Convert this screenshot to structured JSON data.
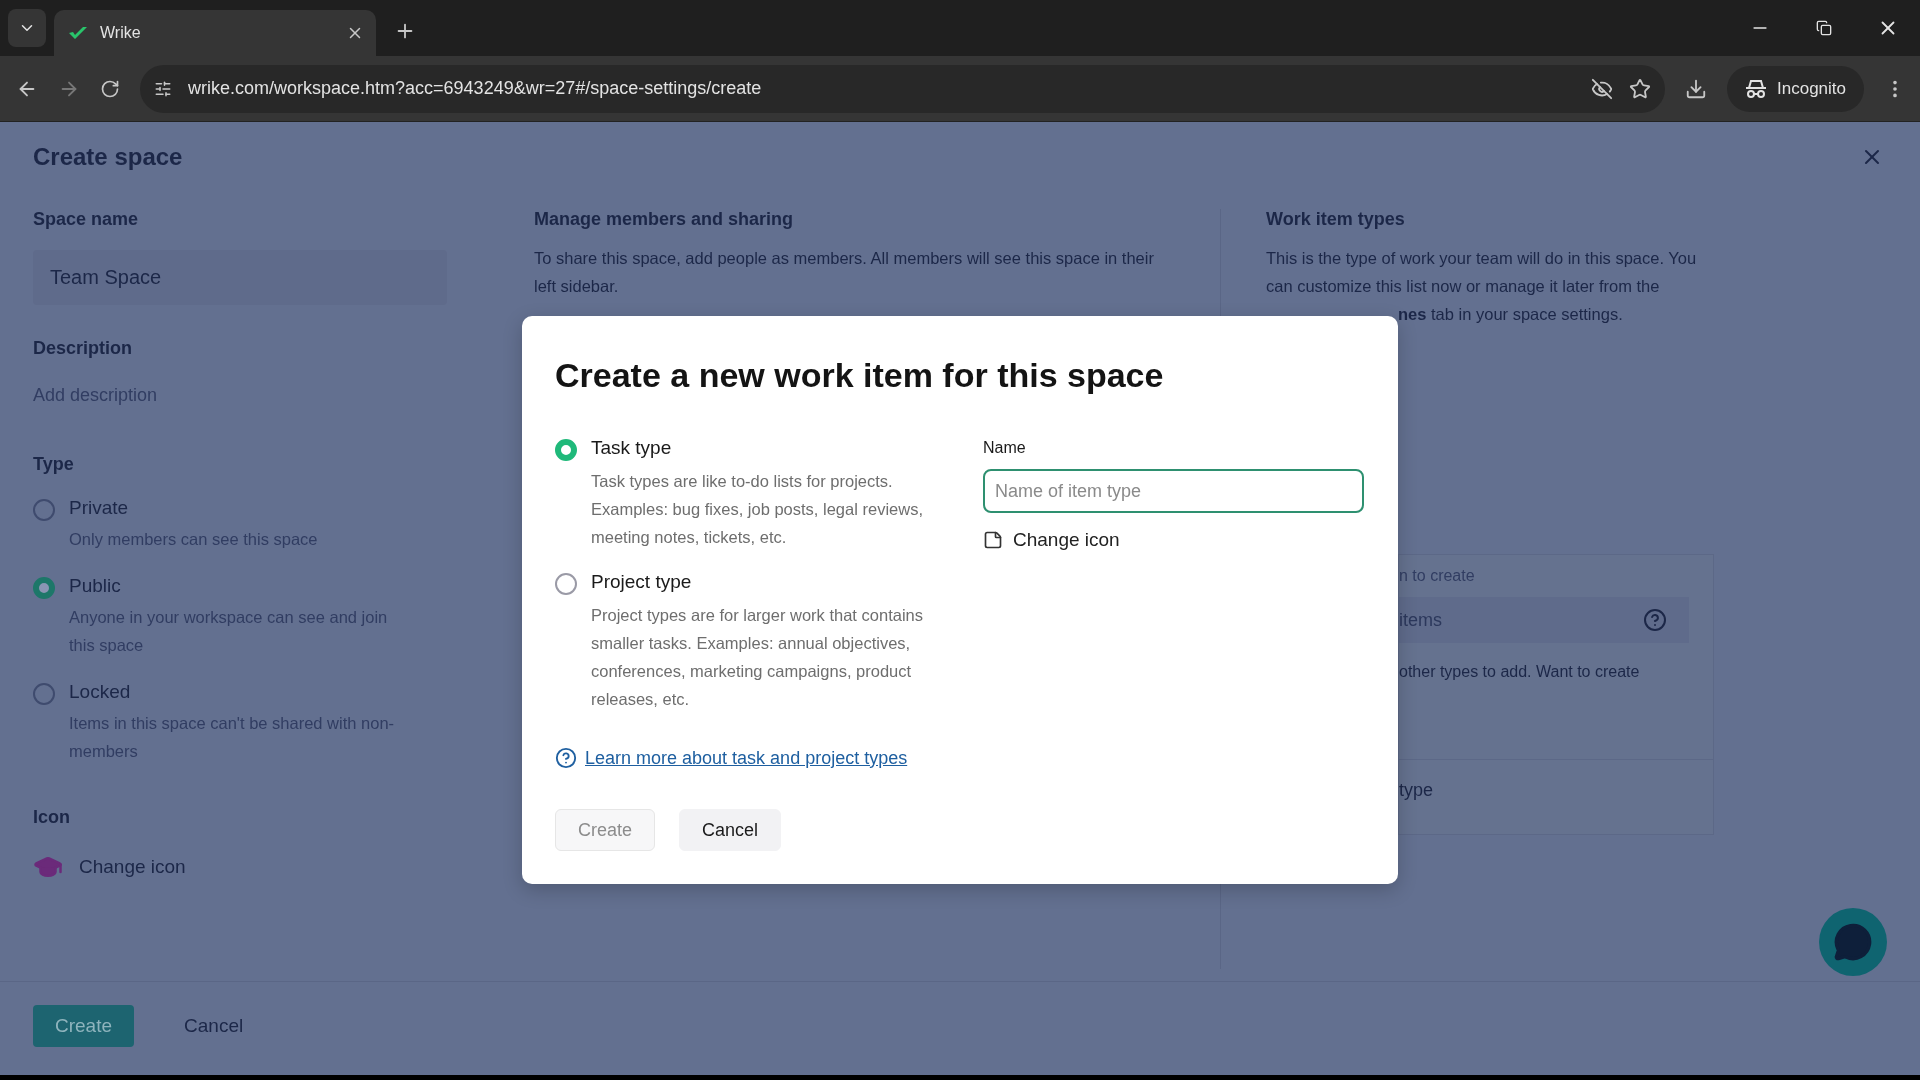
{
  "browser": {
    "tab_title": "Wrike",
    "url": "wrike.com/workspace.htm?acc=6943249&wr=27#/space-settings/create",
    "profile_label": "Incognito"
  },
  "page": {
    "title": "Create space",
    "space_name_label": "Space name",
    "space_name_value": "Team Space",
    "description_label": "Description",
    "description_placeholder": "Add description",
    "type_label": "Type",
    "type_options": [
      {
        "label": "Private",
        "description": "Only members can see this space",
        "selected": false
      },
      {
        "label": "Public",
        "description": "Anyone in your workspace can see and join this space",
        "selected": true
      },
      {
        "label": "Locked",
        "description": "Items in this space can't be shared with non-members",
        "selected": false
      }
    ],
    "icon_label": "Icon",
    "change_icon": "Change icon",
    "footer_buttons": [
      {
        "label": "Create",
        "kind": "primary"
      },
      {
        "label": "Cancel",
        "kind": "plain"
      }
    ]
  },
  "members": {
    "heading": "Manage members and sharing",
    "description": "To share this space, add people as members. All members will see this space in their left sidebar."
  },
  "work_item_types": {
    "heading": "Work item types",
    "description": "This is the type of work your team will do in this space. You can customize this list now or manage it later from the",
    "description_tail": "**nes** tab in your space settings.",
    "card_hint": "n to create",
    "card_field": "items",
    "card_text": "other types to add. Want to create",
    "card_action": "type"
  },
  "modal": {
    "title": "Create a new work item for this space",
    "options": [
      {
        "label": "Task type",
        "description": "Task types are like to-do lists for projects. Examples: bug fixes, job posts, legal reviews, meeting notes, tickets, etc.",
        "selected": true
      },
      {
        "label": "Project type",
        "description": "Project types are for larger work that contains smaller tasks. Examples: annual objectives, conferences, marketing campaigns, product releases, etc.",
        "selected": false
      }
    ],
    "help_link": "Learn more about task and project types",
    "name_label": "Name",
    "name_placeholder": "Name of item type",
    "change_icon": "Change icon",
    "buttons": [
      {
        "label": "Create",
        "disabled": true
      },
      {
        "label": "Cancel",
        "disabled": false
      }
    ]
  }
}
